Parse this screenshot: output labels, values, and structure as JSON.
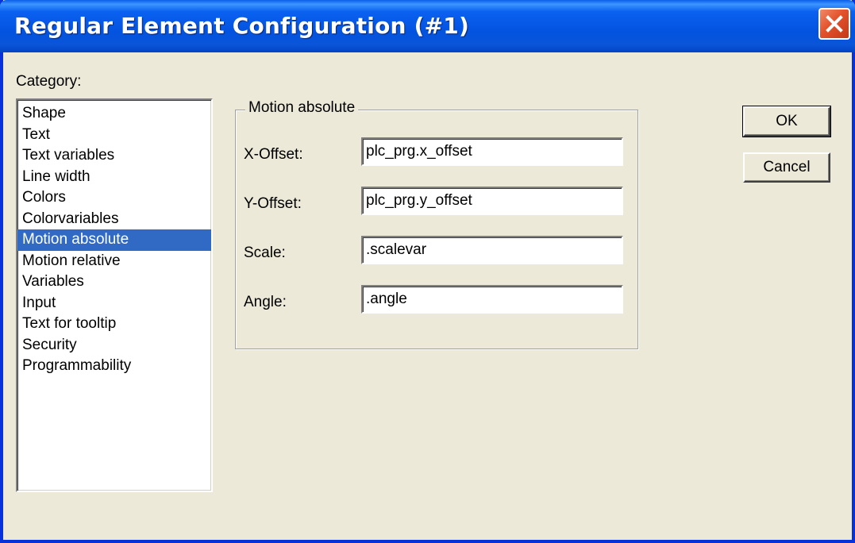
{
  "window": {
    "title": "Regular Element Configuration (#1)"
  },
  "category": {
    "label": "Category:",
    "items": [
      {
        "label": "Shape"
      },
      {
        "label": "Text"
      },
      {
        "label": "Text variables"
      },
      {
        "label": "Line width"
      },
      {
        "label": "Colors"
      },
      {
        "label": "Colorvariables"
      },
      {
        "label": "Motion absolute",
        "selected": true
      },
      {
        "label": "Motion relative"
      },
      {
        "label": "Variables"
      },
      {
        "label": "Input"
      },
      {
        "label": "Text for tooltip"
      },
      {
        "label": "Security"
      },
      {
        "label": "Programmability"
      }
    ]
  },
  "group": {
    "title": "Motion absolute",
    "fields": [
      {
        "label": "X-Offset:",
        "value": "plc_prg.x_offset"
      },
      {
        "label": "Y-Offset:",
        "value": "plc_prg.y_offset"
      },
      {
        "label": "Scale:",
        "value": ".scalevar"
      },
      {
        "label": "Angle:",
        "value": ".angle"
      }
    ]
  },
  "buttons": {
    "ok": "OK",
    "cancel": "Cancel"
  },
  "colors": {
    "titlebar": "#0353e0",
    "selection": "#316ac5",
    "face": "#ece9d8",
    "close": "#e2512a"
  },
  "icons": {
    "close": "close-x-icon"
  }
}
